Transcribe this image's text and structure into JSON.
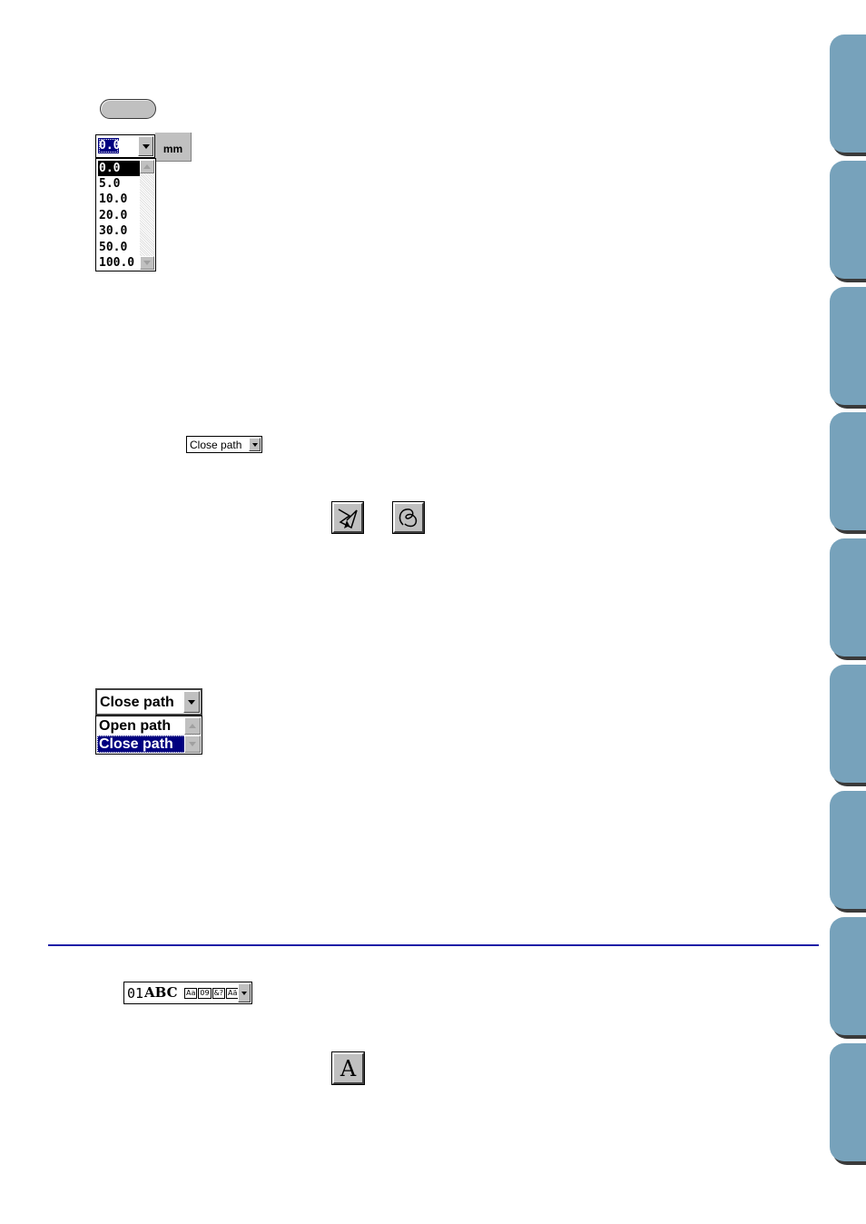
{
  "mm_dropdown": {
    "value": "0.0",
    "unit": "mm",
    "options": [
      "0.0",
      "5.0",
      "10.0",
      "20.0",
      "30.0",
      "50.0",
      "100.0"
    ],
    "selected_index": 0
  },
  "path_small": {
    "value": "Close path"
  },
  "path_large": {
    "value": "Close path",
    "options": [
      "Open path",
      "Close path"
    ],
    "selected_index": 1
  },
  "font_select": {
    "number": "01",
    "sample": "ABC",
    "badges": [
      "Aa",
      "09",
      "&?",
      "Aä"
    ]
  },
  "text_tool": {
    "glyph": "A"
  },
  "colors": {
    "tab": "#77a2bb",
    "rule": "#1c1ca6",
    "selection": "#000080"
  },
  "side_tabs": [
    {},
    {},
    {},
    {},
    {},
    {},
    {},
    {},
    {}
  ]
}
